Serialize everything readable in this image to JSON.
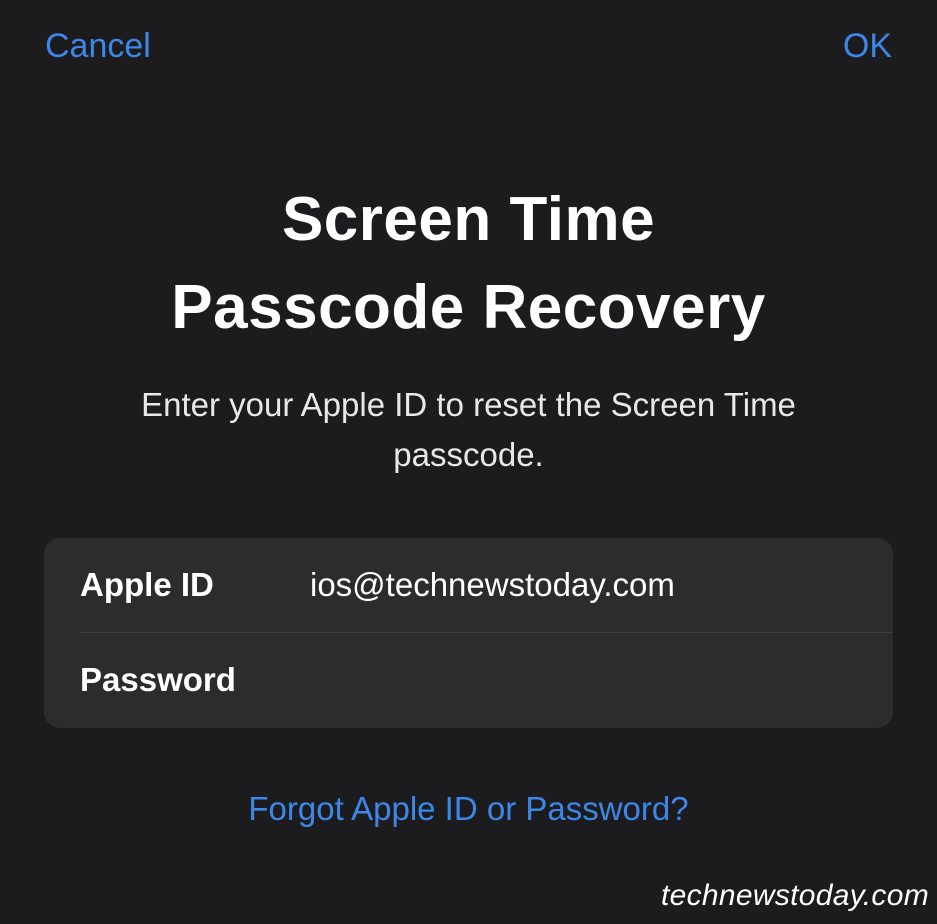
{
  "nav": {
    "cancel_label": "Cancel",
    "ok_label": "OK"
  },
  "title": {
    "line1": "Screen Time",
    "line2": "Passcode Recovery"
  },
  "subtitle": "Enter your Apple ID to reset the Screen Time passcode.",
  "form": {
    "apple_id": {
      "label": "Apple ID",
      "value": "ios@technewstoday.com"
    },
    "password": {
      "label": "Password",
      "value": ""
    }
  },
  "forgot_link": "Forgot Apple ID or Password?",
  "watermark": "technewstoday.com",
  "colors": {
    "background": "#1c1c1e",
    "card": "#2c2c2e",
    "accent": "#3d87e8",
    "text": "#ffffff"
  }
}
